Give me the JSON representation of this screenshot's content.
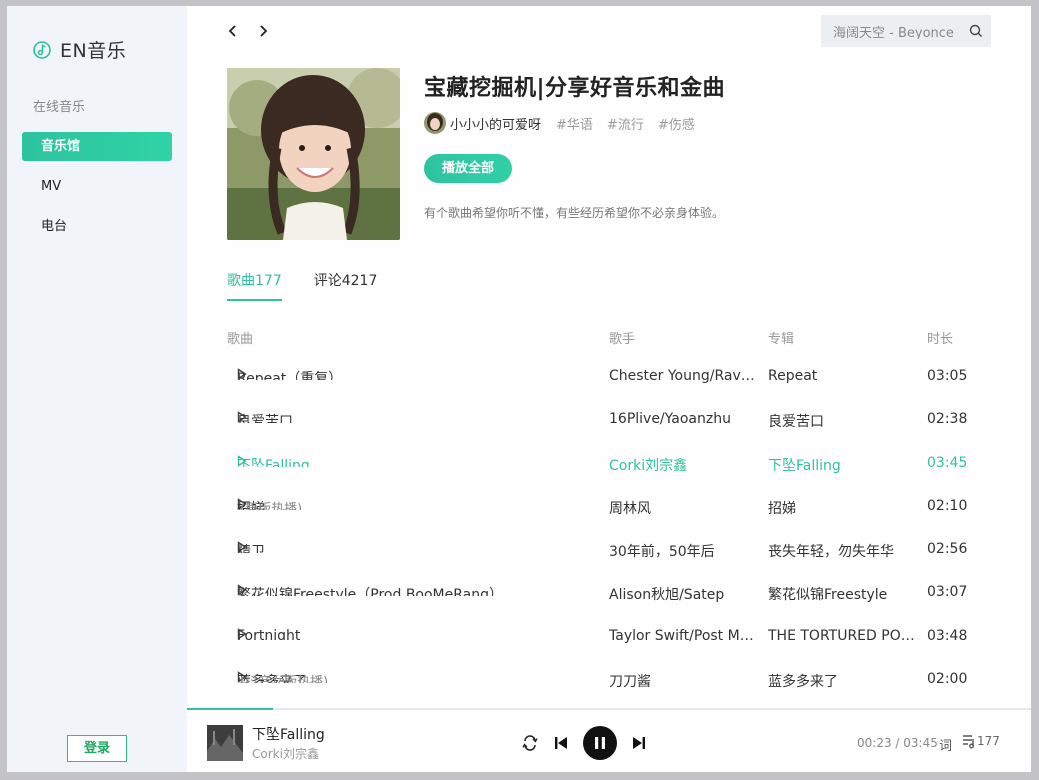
{
  "app": {
    "name": "EN音乐"
  },
  "sidebar": {
    "section_title": "在线音乐",
    "items": [
      {
        "label": "音乐馆",
        "active": true
      },
      {
        "label": "MV",
        "active": false
      },
      {
        "label": "电台",
        "active": false
      }
    ],
    "login_label": "登录"
  },
  "search": {
    "value": "海阔天空 - Beyonce"
  },
  "playlist": {
    "title": "宝藏挖掘机|分享好音乐和金曲",
    "author": "小小小的可爱呀",
    "tags": [
      "#华语",
      "#流行",
      "#伤感"
    ],
    "play_all_label": "播放全部",
    "description": "有个歌曲希望你听不懂，有些经历希望你不必亲身体验。"
  },
  "tabs": [
    {
      "label": "歌曲177",
      "active": true
    },
    {
      "label": "评论4217",
      "active": false
    }
  ],
  "table": {
    "headers": {
      "song": "歌曲",
      "artist": "歌手",
      "album": "专辑",
      "duration": "时长"
    },
    "rows": [
      {
        "title": "Repeat（重复）",
        "sub": "",
        "artist": "Chester Young/Ravenna Golden",
        "album": "Repeat",
        "duration": "03:05",
        "playing": false
      },
      {
        "title": "良爱苦口",
        "sub": "",
        "artist": "16Plive/Yaoanzhu",
        "album": "良爱苦口",
        "duration": "02:38",
        "playing": false
      },
      {
        "title": "下坠Falling",
        "sub": "",
        "artist": "Corki刘宗鑫",
        "album": "下坠Falling",
        "duration": "03:45",
        "playing": true
      },
      {
        "title": "招娣",
        "sub": "(原版热播)",
        "artist": "周林风",
        "album": "招娣",
        "duration": "02:10",
        "playing": false
      },
      {
        "title": "精卫",
        "sub": "",
        "artist": "30年前，50年后",
        "album": "丧失年轻，勿失年华",
        "duration": "02:56",
        "playing": false
      },
      {
        "title": "繁花似锦Freestyle（Prod.BooMeRang）",
        "sub": "",
        "artist": "Alison秋旭/Satep",
        "album": "繁花似锦Freestyle",
        "duration": "03:07",
        "playing": false
      },
      {
        "title": "Fortnight",
        "sub": "",
        "artist": "Taylor Swift/Post Malone",
        "album": "THE TORTURED POETS DEPARTMENT",
        "duration": "03:48",
        "playing": false
      },
      {
        "title": "蓝多多来了",
        "sub": "(抖音女版热播)",
        "artist": "刀刀酱",
        "album": "蓝多多来了",
        "duration": "02:00",
        "playing": false
      }
    ]
  },
  "player": {
    "title": "下坠Falling",
    "artist": "Corki刘宗鑫",
    "current_time": "00:23",
    "total_time": "03:45",
    "time_text": "00:23 / 03:45",
    "progress_fraction": 0.102,
    "lyric_label": "词",
    "queue_count": "177"
  },
  "colors": {
    "accent": "#32c0a0",
    "login_green": "#22a764"
  },
  "icons": {
    "logo": "music-note-icon",
    "back": "chevron-left-icon",
    "forward": "chevron-right-icon",
    "search": "search-icon",
    "loop": "loop-icon",
    "prev": "skip-previous-icon",
    "pause": "pause-icon",
    "next": "skip-next-icon",
    "queue": "playlist-icon"
  }
}
